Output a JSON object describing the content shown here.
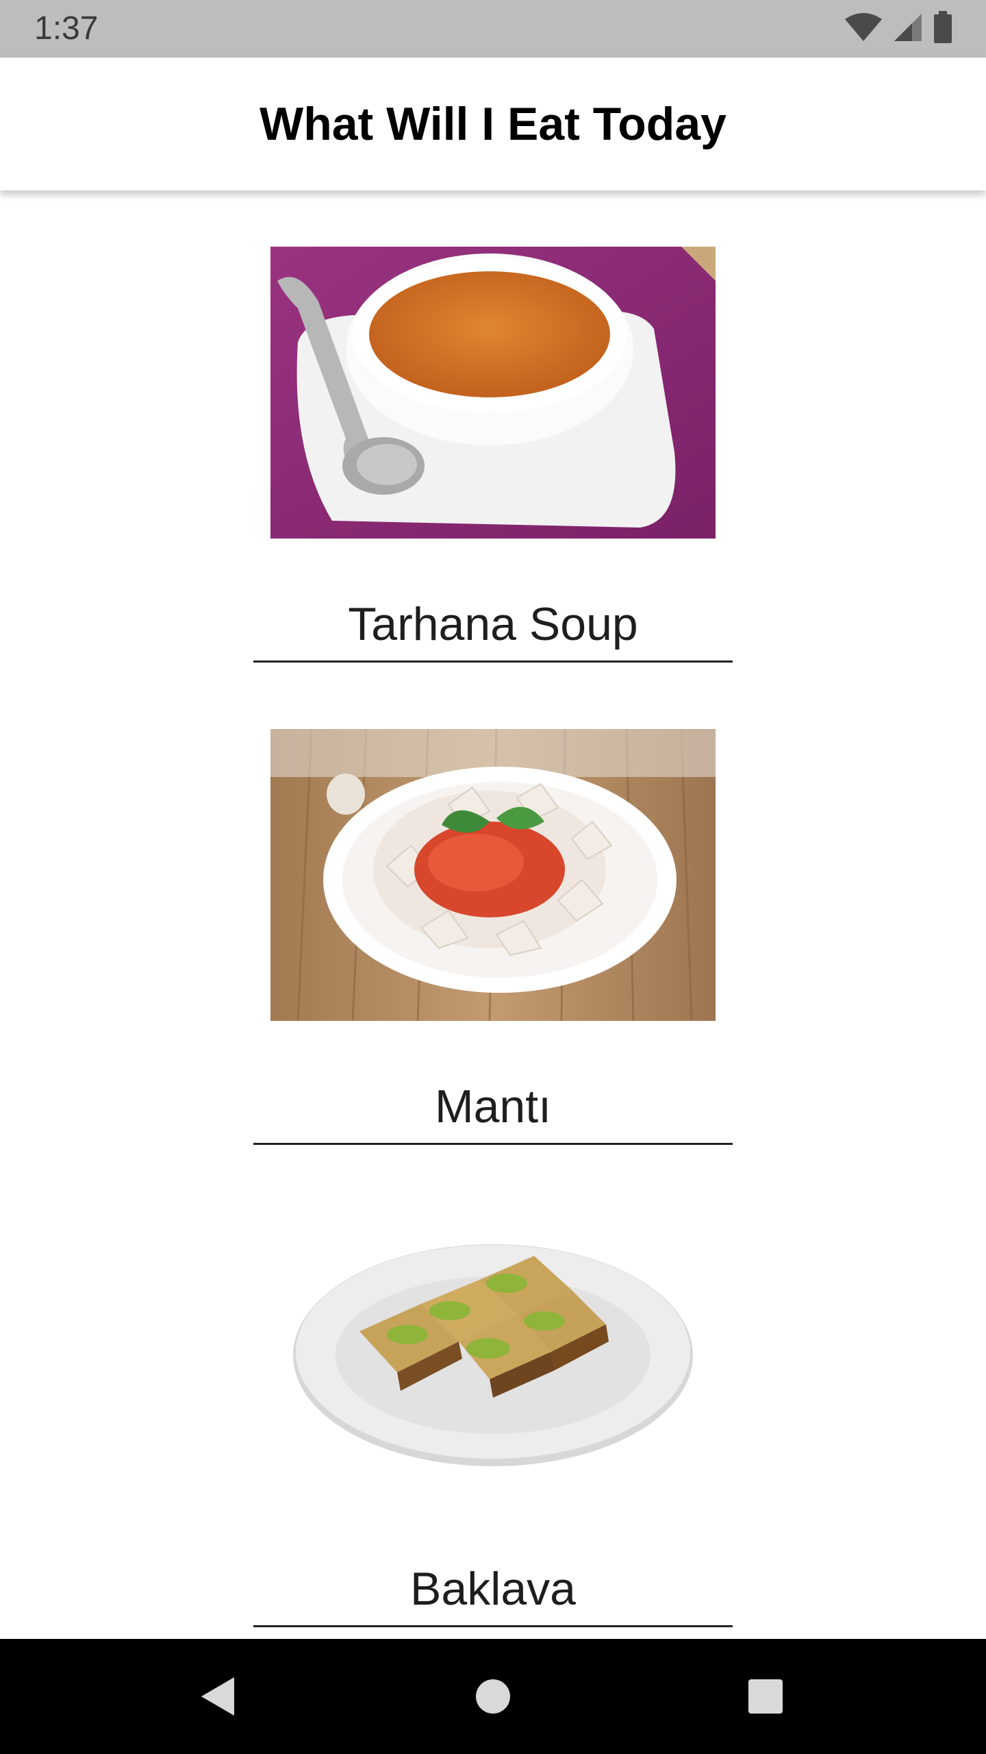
{
  "status_bar": {
    "time": "1:37",
    "icons": [
      "wifi-icon",
      "cell-signal-icon",
      "battery-icon"
    ]
  },
  "app_bar": {
    "title": "What Will I Eat Today"
  },
  "foods": [
    {
      "name": "Tarhana Soup",
      "image": "tarhana-soup-image"
    },
    {
      "name": "Mantı",
      "image": "manti-image"
    },
    {
      "name": "Baklava",
      "image": "baklava-image"
    }
  ],
  "nav_bar": {
    "buttons": [
      "back-icon",
      "home-icon",
      "recents-icon"
    ]
  },
  "colors": {
    "status_bar_bg": "#bdbdbd",
    "app_bar_bg": "#ffffff",
    "nav_bar_bg": "#000000",
    "soup_placemat": "#8e2a78",
    "soup_broth": "#d9752a"
  }
}
